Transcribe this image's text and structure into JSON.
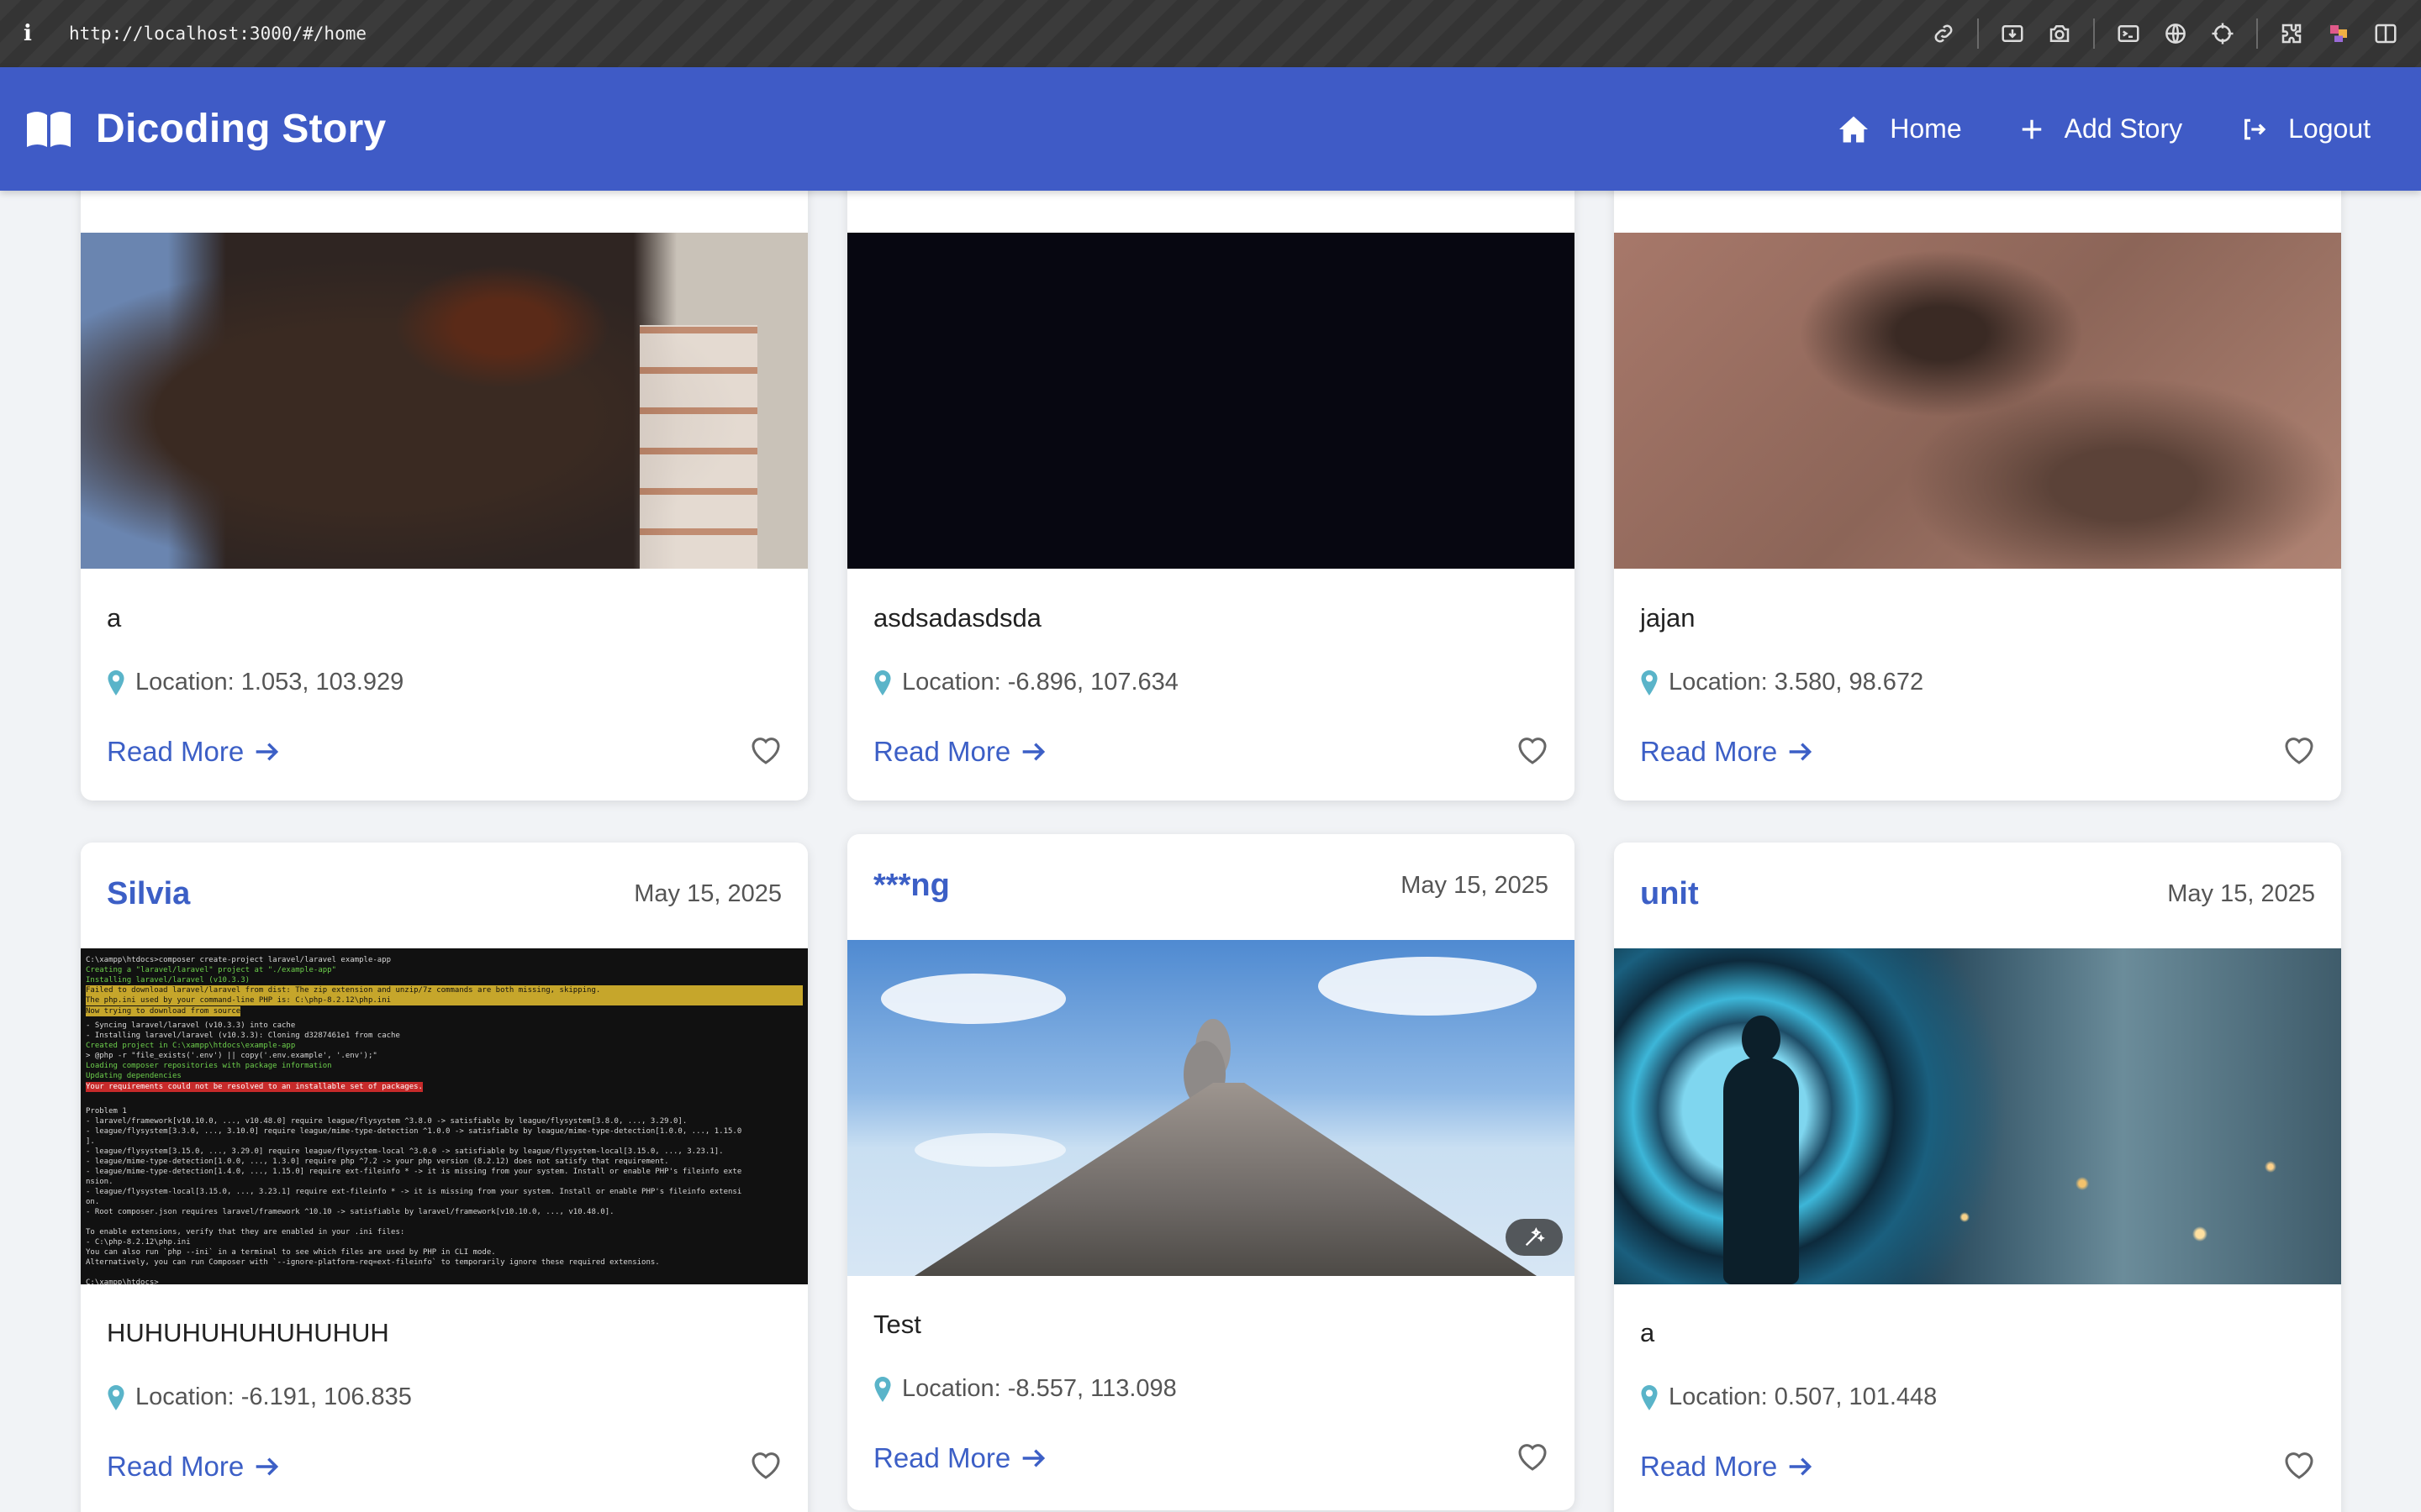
{
  "browser": {
    "url": "http://localhost:3000/#/home"
  },
  "header": {
    "brand": "Dicoding Story",
    "nav": {
      "home": "Home",
      "add_story": "Add Story",
      "logout": "Logout"
    }
  },
  "colors": {
    "header_bg": "#3f5bc6",
    "accent": "#3c5fc6",
    "location_icon": "#5ab4c9"
  },
  "stories": [
    {
      "name": "",
      "date": "",
      "description": "a",
      "location": "Location: 1.053, 103.929",
      "read_more": "Read More",
      "image": "bear-photo"
    },
    {
      "name": "",
      "date": "",
      "description": "asdsadasdsda",
      "location": "Location: -6.896, 107.634",
      "read_more": "Read More",
      "image": "dark-photo"
    },
    {
      "name": "",
      "date": "",
      "description": "jajan",
      "location": "Location: 3.580, 98.672",
      "read_more": "Read More",
      "image": "skin-closeup-photo"
    },
    {
      "name": "Silvia",
      "date": "May 15, 2025",
      "description": "HUHUHUHUHUHUHUH",
      "location": "Location: -6.191, 106.835",
      "read_more": "Read More",
      "image": "terminal-screenshot"
    },
    {
      "name": "***ng",
      "date": "May 15, 2025",
      "description": "Test",
      "location": "Location: -8.557, 113.098",
      "read_more": "Read More",
      "image": "volcano-photo"
    },
    {
      "name": "unit",
      "date": "May 15, 2025",
      "description": "a",
      "location": "Location: 0.507, 101.448",
      "read_more": "Read More",
      "image": "hero-portal-artwork"
    }
  ],
  "terminal_lines": [
    "C:\\xampp\\htdocs>composer create-project laravel/laravel example-app",
    "Creating a \"laravel/laravel\" project at \"./example-app\"",
    "Installing laravel/laravel (v10.3.3)",
    "  Failed to download laravel/laravel from dist: The zip extension and unzip/7z commands are both missing, skipping.",
    "The php.ini used by your command-line PHP is: C:\\php-8.2.12\\php.ini",
    "  Now trying to download from source",
    "  - Syncing laravel/laravel (v10.3.3) into cache",
    "  - Installing laravel/laravel (v10.3.3): Cloning d3287461e1 from cache",
    "Created project in C:\\xampp\\htdocs\\example-app",
    "> @php -r \"file_exists('.env') || copy('.env.example', '.env');\"",
    "Loading composer repositories with package information",
    "Updating dependencies",
    "Your requirements could not be resolved to an installable set of packages.",
    "",
    "  Problem 1",
    "    - laravel/framework[v10.10.0, ..., v10.48.0] require league/flysystem ^3.8.0 -> satisfiable by league/flysystem[3.8.0, ..., 3.29.0].",
    "    - league/flysystem[3.3.0, ..., 3.10.0] require league/mime-type-detection ^1.0.0 -> satisfiable by league/mime-type-detection[1.0.0, ..., 1.15.0",
    "].",
    "    - league/flysystem[3.15.0, ..., 3.29.0] require league/flysystem-local ^3.0.0 -> satisfiable by league/flysystem-local[3.15.0, ..., 3.23.1].",
    "    - league/mime-type-detection[1.0.0, ..., 1.3.0] require php ^7.2 -> your php version (8.2.12) does not satisfy that requirement.",
    "    - league/mime-type-detection[1.4.0, ..., 1.15.0] require ext-fileinfo * -> it is missing from your system. Install or enable PHP's fileinfo exte",
    "nsion.",
    "    - league/flysystem-local[3.15.0, ..., 3.23.1] require ext-fileinfo * -> it is missing from your system. Install or enable PHP's fileinfo extensi",
    "on.",
    "    - Root composer.json requires laravel/framework ^10.10 -> satisfiable by laravel/framework[v10.10.0, ..., v10.48.0].",
    "",
    "To enable extensions, verify that they are enabled in your .ini files:",
    "    - C:\\php-8.2.12\\php.ini",
    "You can also run `php --ini` in a terminal to see which files are used by PHP in CLI mode.",
    "Alternatively, you can run Composer with `--ignore-platform-req=ext-fileinfo` to temporarily ignore these required extensions.",
    "",
    "C:\\xampp\\htdocs>"
  ]
}
